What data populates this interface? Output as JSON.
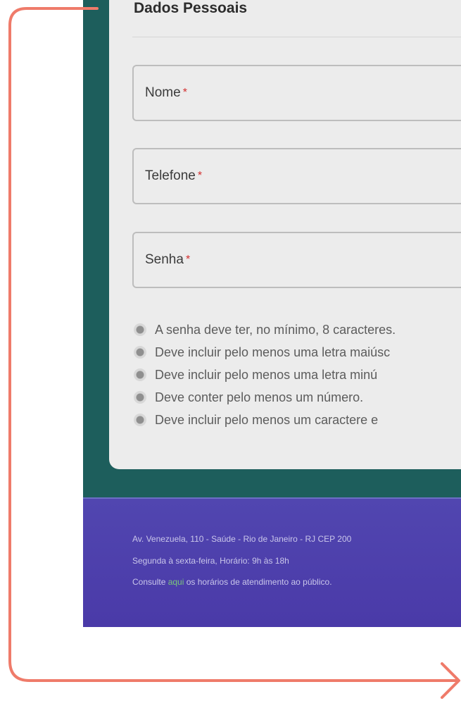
{
  "form": {
    "section_title": "Dados Pessoais",
    "required_marker": "*",
    "fields": [
      {
        "label": "Nome"
      },
      {
        "label": "Telefone"
      },
      {
        "label": "Senha"
      }
    ],
    "password_rules": [
      "A senha deve ter, no mínimo, 8 caracteres.",
      "Deve incluir pelo menos uma letra maiúsc",
      "Deve incluir pelo menos uma letra minú",
      "Deve conter pelo menos um número.",
      "Deve incluir pelo menos um caractere e"
    ]
  },
  "footer": {
    "address": "Av. Venezuela, 110 - Saúde - Rio de Janeiro - RJ CEP 200",
    "hours": "Segunda à sexta-feira, Horário: 9h às 18h",
    "consult_prefix": "Consulte ",
    "consult_link": "aqui",
    "consult_suffix": " os horários de atendimento ao público."
  },
  "colors": {
    "frame": "#1d5e5c",
    "footer": "#4a3aa8",
    "arrow": "#ef7b6a",
    "required": "#d32f2f",
    "link": "#7bc67b"
  }
}
